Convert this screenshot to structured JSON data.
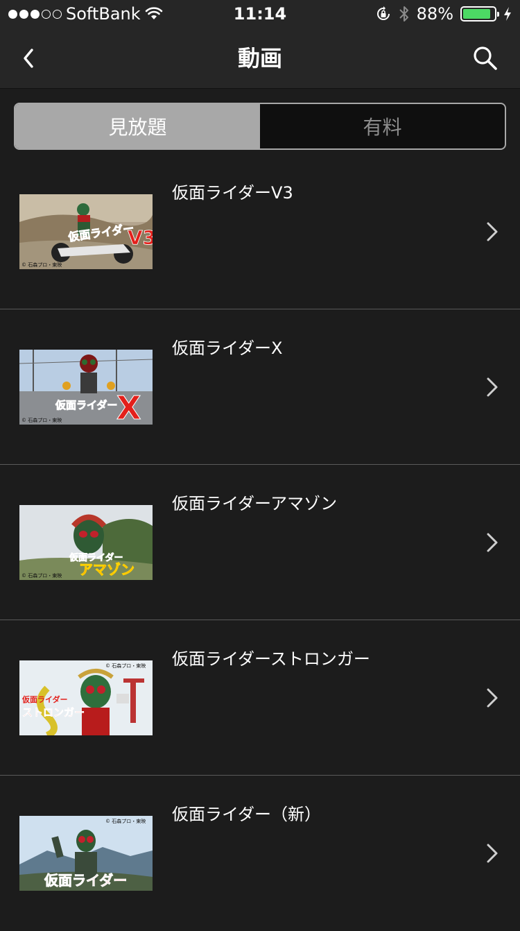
{
  "status_bar": {
    "carrier": "SoftBank",
    "time": "11:14",
    "battery": "88%",
    "battery_level": 0.88,
    "signal_bars_full": 3,
    "signal_bars_total": 5
  },
  "nav": {
    "title": "動画",
    "back_icon": "chevron-left-icon",
    "search_icon": "search-icon"
  },
  "tabs": [
    {
      "label": "見放題",
      "selected": true
    },
    {
      "label": "有料",
      "selected": false
    }
  ],
  "items": [
    {
      "title": "仮面ライダーV3",
      "thumb_logo": "仮面ライダー",
      "thumb_suffix": "V3",
      "copyright": "© 石森プロ・東映"
    },
    {
      "title": "仮面ライダーX",
      "thumb_logo": "仮面ライダー",
      "thumb_suffix": "X",
      "copyright": "© 石森プロ・東映"
    },
    {
      "title": "仮面ライダーアマゾン",
      "thumb_logo": "仮面ライダー",
      "thumb_suffix": "アマゾン",
      "copyright": "© 石森プロ・東映"
    },
    {
      "title": "仮面ライダーストロンガー",
      "thumb_logo": "仮面ライダー",
      "thumb_suffix": "ストロンガー",
      "copyright": "© 石森プロ・東映"
    },
    {
      "title": "仮面ライダー（新）",
      "thumb_logo": "仮面ライダー",
      "thumb_suffix": "",
      "copyright": "© 石森プロ・東映"
    }
  ],
  "colors": {
    "background": "#1c1c1c",
    "nav_background": "#262626",
    "segment_active": "#a8a8a8",
    "battery_green": "#4cd964"
  }
}
